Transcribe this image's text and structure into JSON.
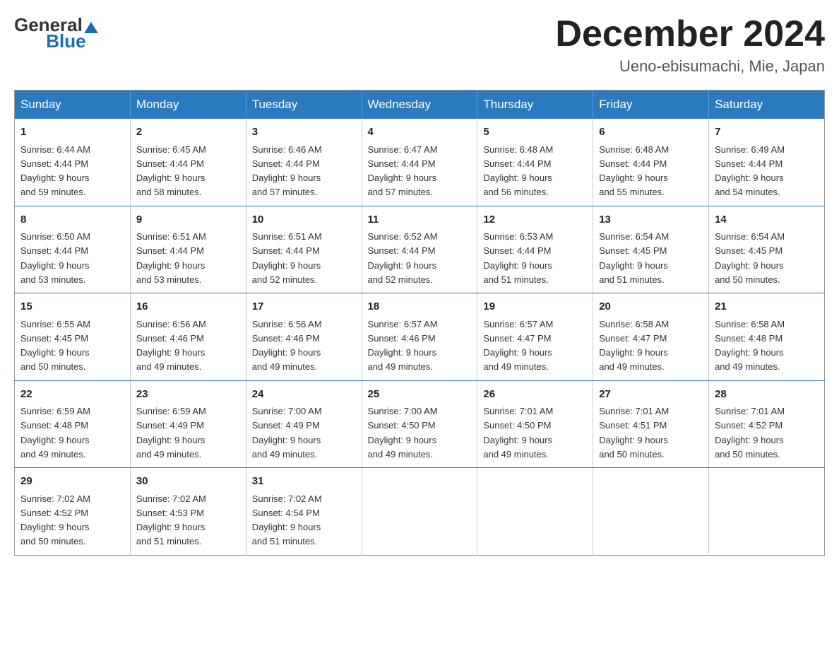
{
  "header": {
    "logo_general": "General",
    "logo_blue": "Blue",
    "month_title": "December 2024",
    "location": "Ueno-ebisumachi, Mie, Japan"
  },
  "days_of_week": [
    "Sunday",
    "Monday",
    "Tuesday",
    "Wednesday",
    "Thursday",
    "Friday",
    "Saturday"
  ],
  "weeks": [
    [
      {
        "day": "1",
        "sunrise": "6:44 AM",
        "sunset": "4:44 PM",
        "daylight": "9 hours and 59 minutes."
      },
      {
        "day": "2",
        "sunrise": "6:45 AM",
        "sunset": "4:44 PM",
        "daylight": "9 hours and 58 minutes."
      },
      {
        "day": "3",
        "sunrise": "6:46 AM",
        "sunset": "4:44 PM",
        "daylight": "9 hours and 57 minutes."
      },
      {
        "day": "4",
        "sunrise": "6:47 AM",
        "sunset": "4:44 PM",
        "daylight": "9 hours and 57 minutes."
      },
      {
        "day": "5",
        "sunrise": "6:48 AM",
        "sunset": "4:44 PM",
        "daylight": "9 hours and 56 minutes."
      },
      {
        "day": "6",
        "sunrise": "6:48 AM",
        "sunset": "4:44 PM",
        "daylight": "9 hours and 55 minutes."
      },
      {
        "day": "7",
        "sunrise": "6:49 AM",
        "sunset": "4:44 PM",
        "daylight": "9 hours and 54 minutes."
      }
    ],
    [
      {
        "day": "8",
        "sunrise": "6:50 AM",
        "sunset": "4:44 PM",
        "daylight": "9 hours and 53 minutes."
      },
      {
        "day": "9",
        "sunrise": "6:51 AM",
        "sunset": "4:44 PM",
        "daylight": "9 hours and 53 minutes."
      },
      {
        "day": "10",
        "sunrise": "6:51 AM",
        "sunset": "4:44 PM",
        "daylight": "9 hours and 52 minutes."
      },
      {
        "day": "11",
        "sunrise": "6:52 AM",
        "sunset": "4:44 PM",
        "daylight": "9 hours and 52 minutes."
      },
      {
        "day": "12",
        "sunrise": "6:53 AM",
        "sunset": "4:44 PM",
        "daylight": "9 hours and 51 minutes."
      },
      {
        "day": "13",
        "sunrise": "6:54 AM",
        "sunset": "4:45 PM",
        "daylight": "9 hours and 51 minutes."
      },
      {
        "day": "14",
        "sunrise": "6:54 AM",
        "sunset": "4:45 PM",
        "daylight": "9 hours and 50 minutes."
      }
    ],
    [
      {
        "day": "15",
        "sunrise": "6:55 AM",
        "sunset": "4:45 PM",
        "daylight": "9 hours and 50 minutes."
      },
      {
        "day": "16",
        "sunrise": "6:56 AM",
        "sunset": "4:46 PM",
        "daylight": "9 hours and 49 minutes."
      },
      {
        "day": "17",
        "sunrise": "6:56 AM",
        "sunset": "4:46 PM",
        "daylight": "9 hours and 49 minutes."
      },
      {
        "day": "18",
        "sunrise": "6:57 AM",
        "sunset": "4:46 PM",
        "daylight": "9 hours and 49 minutes."
      },
      {
        "day": "19",
        "sunrise": "6:57 AM",
        "sunset": "4:47 PM",
        "daylight": "9 hours and 49 minutes."
      },
      {
        "day": "20",
        "sunrise": "6:58 AM",
        "sunset": "4:47 PM",
        "daylight": "9 hours and 49 minutes."
      },
      {
        "day": "21",
        "sunrise": "6:58 AM",
        "sunset": "4:48 PM",
        "daylight": "9 hours and 49 minutes."
      }
    ],
    [
      {
        "day": "22",
        "sunrise": "6:59 AM",
        "sunset": "4:48 PM",
        "daylight": "9 hours and 49 minutes."
      },
      {
        "day": "23",
        "sunrise": "6:59 AM",
        "sunset": "4:49 PM",
        "daylight": "9 hours and 49 minutes."
      },
      {
        "day": "24",
        "sunrise": "7:00 AM",
        "sunset": "4:49 PM",
        "daylight": "9 hours and 49 minutes."
      },
      {
        "day": "25",
        "sunrise": "7:00 AM",
        "sunset": "4:50 PM",
        "daylight": "9 hours and 49 minutes."
      },
      {
        "day": "26",
        "sunrise": "7:01 AM",
        "sunset": "4:50 PM",
        "daylight": "9 hours and 49 minutes."
      },
      {
        "day": "27",
        "sunrise": "7:01 AM",
        "sunset": "4:51 PM",
        "daylight": "9 hours and 50 minutes."
      },
      {
        "day": "28",
        "sunrise": "7:01 AM",
        "sunset": "4:52 PM",
        "daylight": "9 hours and 50 minutes."
      }
    ],
    [
      {
        "day": "29",
        "sunrise": "7:02 AM",
        "sunset": "4:52 PM",
        "daylight": "9 hours and 50 minutes."
      },
      {
        "day": "30",
        "sunrise": "7:02 AM",
        "sunset": "4:53 PM",
        "daylight": "9 hours and 51 minutes."
      },
      {
        "day": "31",
        "sunrise": "7:02 AM",
        "sunset": "4:54 PM",
        "daylight": "9 hours and 51 minutes."
      },
      null,
      null,
      null,
      null
    ]
  ],
  "labels": {
    "sunrise": "Sunrise:",
    "sunset": "Sunset:",
    "daylight": "Daylight:"
  }
}
